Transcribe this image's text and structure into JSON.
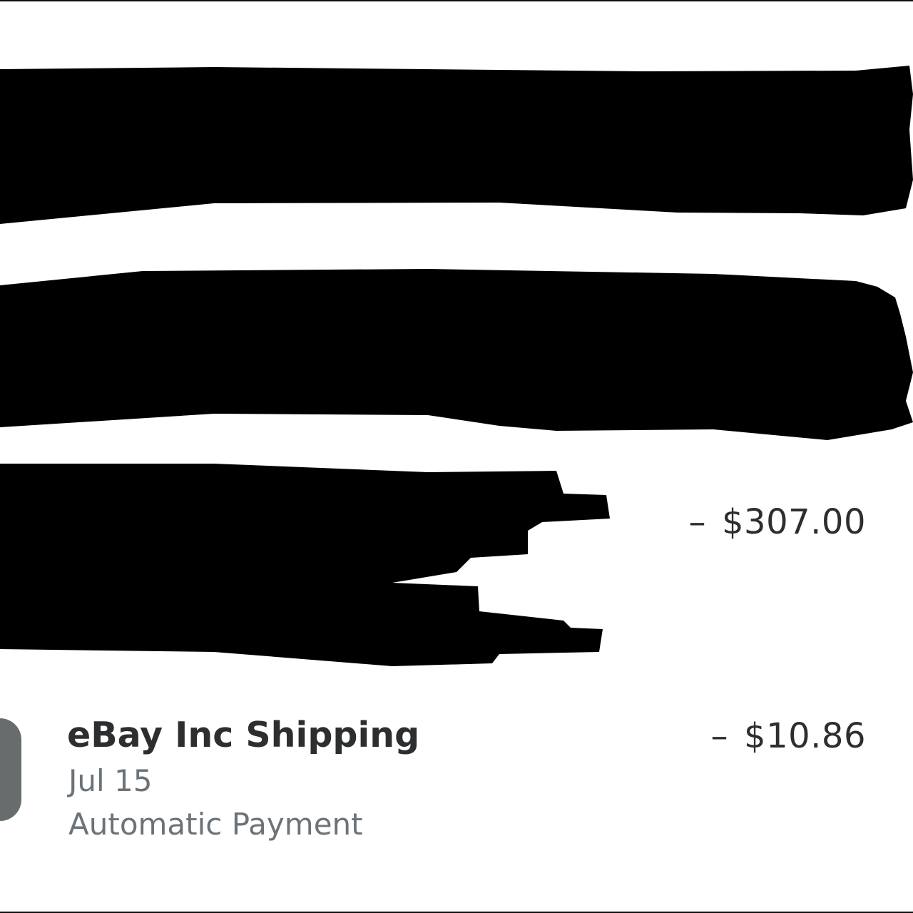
{
  "transactions": [
    {
      "amount_sign": "–",
      "amount_value": "$307.00"
    },
    {
      "merchant": "eBay Inc Shipping",
      "date": "Jul 15",
      "type": "Automatic Payment",
      "amount_sign": "–",
      "amount_value": "$10.86"
    }
  ],
  "colors": {
    "text_primary": "#2c2e2f",
    "text_secondary": "#6c7378",
    "avatar": "#6b7372",
    "redaction": "#000000"
  }
}
